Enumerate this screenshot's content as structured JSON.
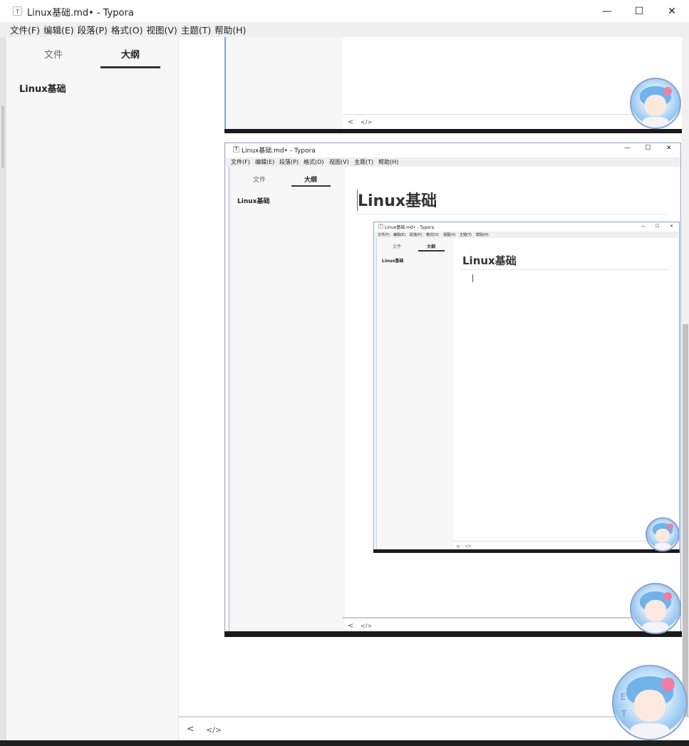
{
  "window": {
    "title": "Linux基础.md• - Typora",
    "app_icon": "T",
    "minimize_icon": "—",
    "maximize_icon": "☐",
    "close_icon": "✕"
  },
  "menu": [
    "文件(F)",
    "编辑(E)",
    "段落(P)",
    "格式(O)",
    "视图(V)",
    "主题(T)",
    "帮助(H)"
  ],
  "sidebar": {
    "tabs": [
      "文件",
      "大纲"
    ],
    "active_tab": "大纲",
    "outline_items": [
      "Linux基础"
    ]
  },
  "status": {
    "back_icon": "<",
    "source_icon": "</>"
  },
  "nested": {
    "heading": "Linux基础",
    "title": "Linux基础.md• - Typora",
    "menu": [
      "文件(F)",
      "编辑(E)",
      "段落(P)",
      "格式(O)",
      "视图(V)",
      "主题(T)",
      "帮助(H)"
    ],
    "tabs": [
      "文件",
      "大纲"
    ],
    "outline_item": "Linux基础"
  },
  "avatar": {
    "letters": [
      "E",
      "T"
    ]
  }
}
